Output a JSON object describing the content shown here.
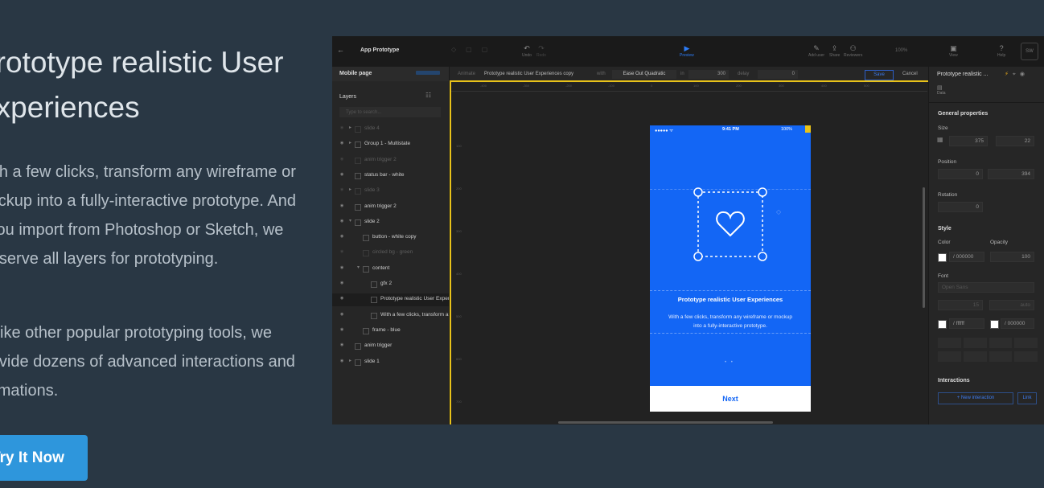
{
  "hero": {
    "title_line1": "Prototype realistic User",
    "title_line2": "Experiences",
    "paragraph1": "With a few clicks, transform any wireframe or mockup into a fully-interactive prototype. And if you import from Photoshop or Sketch, we preserve all layers for prototyping.",
    "paragraph2": "Unlike other popular prototyping tools, we provide dozens of advanced interactions and animations.",
    "cta_label": "Try It Now"
  },
  "app": {
    "title": "App Prototype",
    "toolbar": {
      "undo": "Undo",
      "redo": "Redo",
      "preview": "Preview",
      "add_user": "Add user",
      "share": "Share",
      "reviewers": "Reviewers",
      "zoom": "100%",
      "view": "View",
      "help": "Help",
      "user_initials": "SW"
    },
    "animate_bar": {
      "label_animate": "Animate",
      "target": "Prototype realistic User Experiences copy",
      "label_with": "with",
      "easing": "Ease Out Quadratic",
      "label_in": "in",
      "duration": "300",
      "label_delay": "delay",
      "delay": "0",
      "save": "Save",
      "cancel": "Cancel"
    },
    "left_panel": {
      "page_name": "Mobile page",
      "layers_title": "Layers",
      "search_placeholder": "Type to search...",
      "layers": [
        {
          "name": "slide 4",
          "dim": true,
          "indent": 0,
          "arrow": "▸"
        },
        {
          "name": "Group 1 - Multistate",
          "dim": false,
          "indent": 0,
          "arrow": "▸"
        },
        {
          "name": "anim trigger 2",
          "dim": true,
          "indent": 0,
          "arrow": ""
        },
        {
          "name": "status bar - white",
          "dim": false,
          "indent": 0,
          "arrow": ""
        },
        {
          "name": "slide 3",
          "dim": true,
          "indent": 0,
          "arrow": "▸"
        },
        {
          "name": "anim trigger 2",
          "dim": false,
          "indent": 0,
          "arrow": ""
        },
        {
          "name": "slide 2",
          "dim": false,
          "indent": 0,
          "arrow": "▾"
        },
        {
          "name": "button - white copy",
          "dim": false,
          "indent": 1,
          "arrow": ""
        },
        {
          "name": "circled bg - green",
          "dim": true,
          "indent": 1,
          "arrow": ""
        },
        {
          "name": "content",
          "dim": false,
          "indent": 1,
          "arrow": "▾"
        },
        {
          "name": "gfx 2",
          "dim": false,
          "indent": 2,
          "arrow": ""
        },
        {
          "name": "Prototype realistic User Experiences",
          "dim": false,
          "indent": 2,
          "arrow": "",
          "selected": true
        },
        {
          "name": "With a few clicks, transform any wireframe",
          "dim": false,
          "indent": 2,
          "arrow": ""
        },
        {
          "name": "frame - blue",
          "dim": false,
          "indent": 1,
          "arrow": ""
        },
        {
          "name": "anim trigger",
          "dim": false,
          "indent": 0,
          "arrow": ""
        },
        {
          "name": "slide 1",
          "dim": false,
          "indent": 0,
          "arrow": "▸"
        }
      ]
    },
    "ruler_top": [
      "-400",
      "-350",
      "-200",
      "-100",
      "0",
      "100",
      "200",
      "300",
      "400",
      "500"
    ],
    "ruler_left": [
      "100",
      "200",
      "300",
      "400",
      "500",
      "600",
      "700"
    ],
    "phone": {
      "status_left": "●●●●● ᯤ",
      "time": "9:41 PM",
      "battery": "100%",
      "headline": "Prototype realistic User Experiences",
      "body": "With a few clicks, transform any wireframe or mockup into a fully-interactive prototype.",
      "next": "Next"
    },
    "right_panel": {
      "layer_name": "Prototype realistic ...",
      "tab": "Data",
      "general": "General properties",
      "size_label": "Size",
      "width": "375",
      "height": "22",
      "position_label": "Position",
      "pos_x": "0",
      "pos_y": "394",
      "rotation_label": "Rotation",
      "rotation": "0",
      "style_label": "Style",
      "color_label": "Color",
      "color_value": "000000",
      "opacity_label": "Opacity",
      "opacity_value": "100",
      "font_label": "Font",
      "font_value": "Open Sans",
      "font_size": "15",
      "line_height": "auto",
      "text_color": "ffffff",
      "stroke_color": "000000",
      "interactions_label": "Interactions",
      "new_interaction": "+ New interaction",
      "link": "Link"
    },
    "colors": {
      "accent_blue": "#1366f5",
      "selection_yellow": "#e8c21a",
      "cta_blue": "#2e96dc"
    }
  }
}
